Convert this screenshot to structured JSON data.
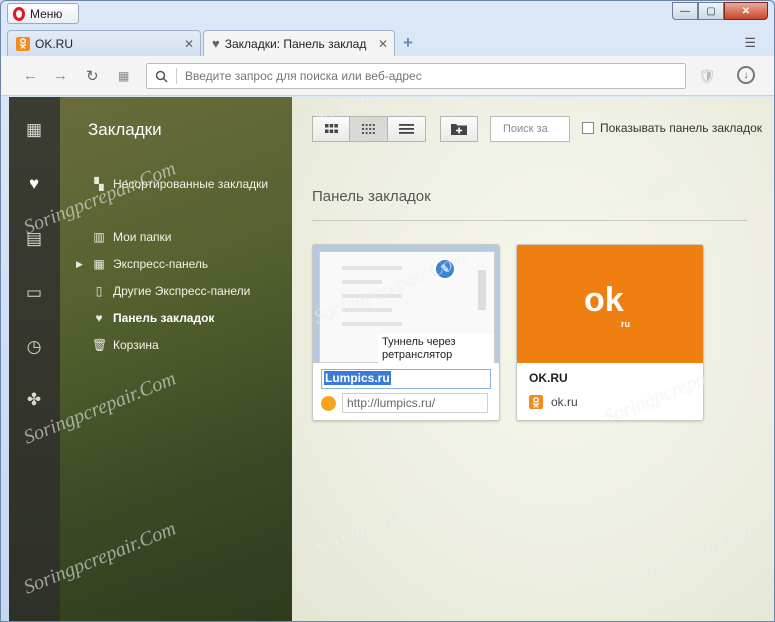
{
  "window": {
    "menu_label": "Меню",
    "minimize": "—",
    "maximize": "▢",
    "close": "✕"
  },
  "tabs": [
    {
      "label": "OK.RU",
      "favicon": "ok-favicon",
      "active": false
    },
    {
      "label": "Закладки: Панель заклад",
      "favicon": "heart-icon",
      "active": true
    }
  ],
  "new_tab": "+",
  "address": {
    "placeholder": "Введите запрос для поиска или веб-адрес",
    "value": ""
  },
  "rail": [
    "speed-dial-icon",
    "heart-icon",
    "news-icon",
    "devices-icon",
    "history-icon",
    "extensions-icon"
  ],
  "sidebar": {
    "title": "Закладки",
    "items": [
      {
        "label": "Несортированные закладки",
        "icon": "unsorted-icon"
      },
      {
        "label": "Мои папки",
        "icon": "folders-icon"
      },
      {
        "label": "Экспресс-панель",
        "icon": "grid-icon"
      },
      {
        "label": "Другие Экспресс-панели",
        "icon": "phone-icon"
      },
      {
        "label": "Панель закладок",
        "icon": "heart-icon",
        "active": true
      },
      {
        "label": "Корзина",
        "icon": "trash-icon"
      }
    ]
  },
  "toolbar": {
    "search_placeholder": "Поиск за",
    "show_bar_label": "Показывать панель закладок"
  },
  "section_title": "Панель закладок",
  "cards": [
    {
      "title": "Lumpics.ru",
      "url": "http://lumpics.ru/",
      "thumb_tooltip": "Туннель через ретранслятор"
    },
    {
      "title": "OK.RU",
      "url": "ok.ru",
      "logo": "ok",
      "logo_sub": "ru"
    }
  ],
  "watermark": "Soringpcrepair.Com",
  "colors": {
    "accent_ok": "#f07f12",
    "selection": "#3a7bd5",
    "opera_red": "#e3171f"
  }
}
